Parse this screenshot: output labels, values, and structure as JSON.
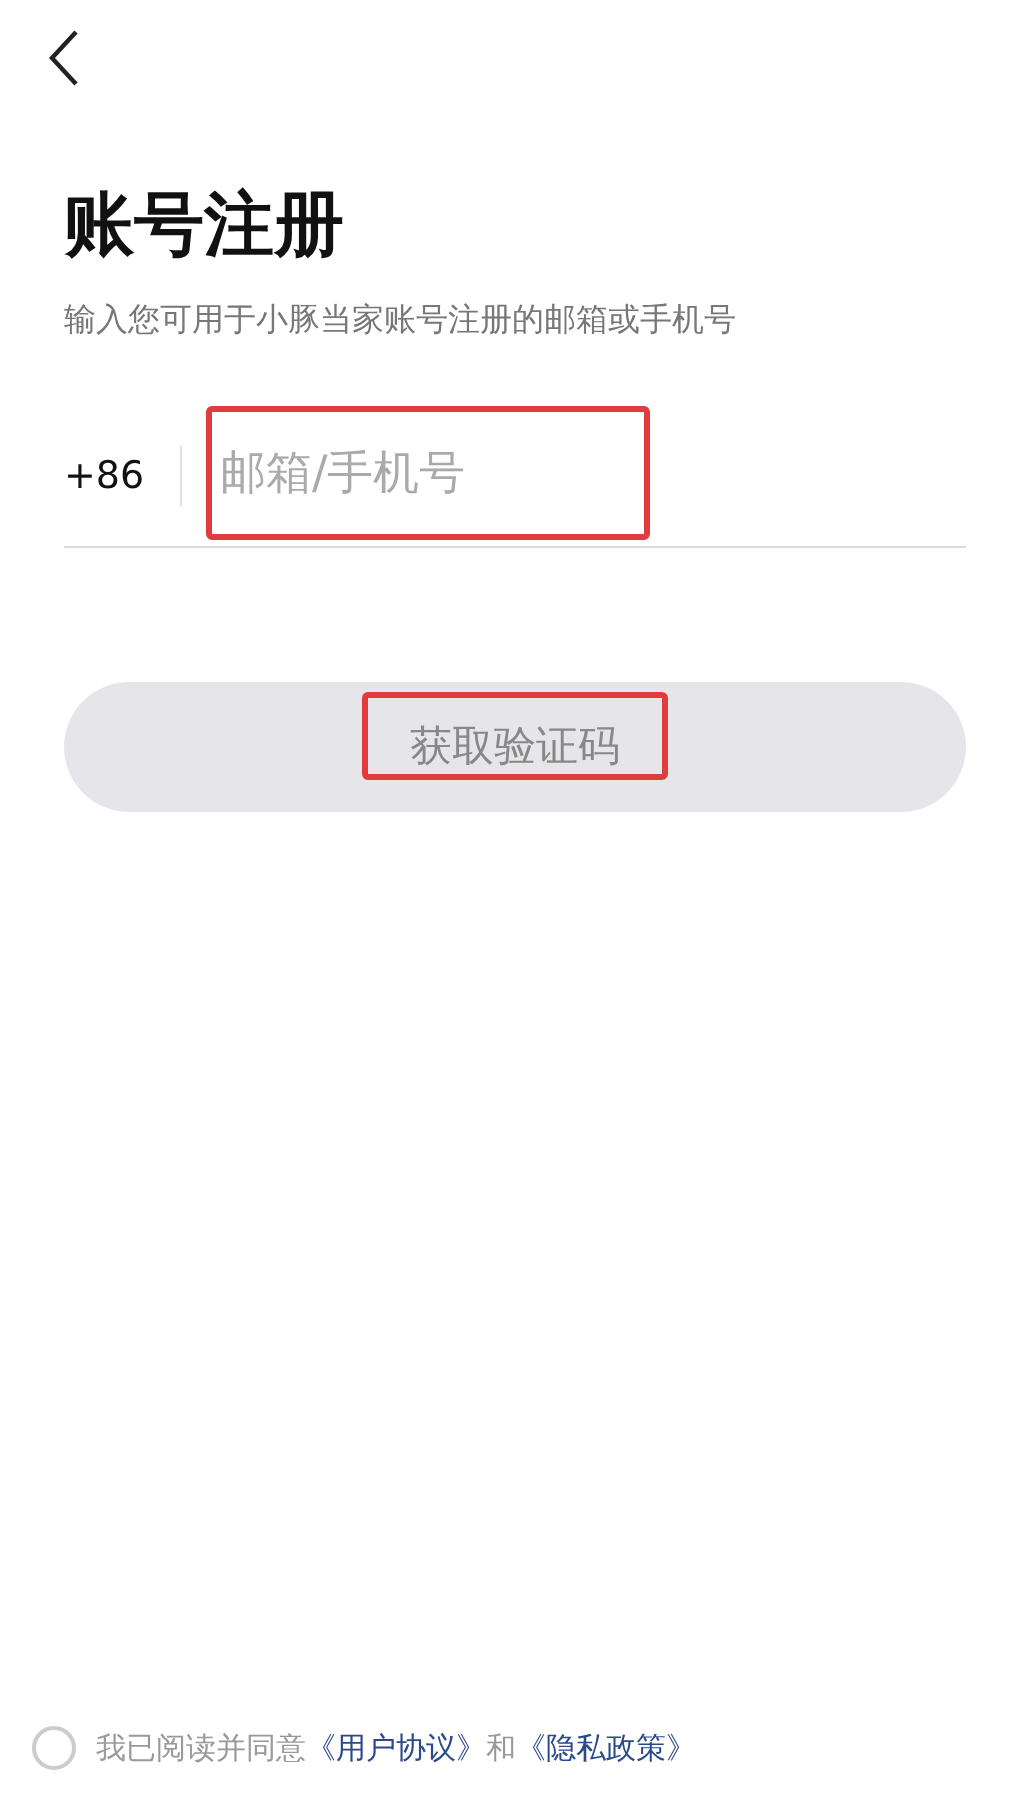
{
  "title": "账号注册",
  "subtitle": "输入您可用于小豚当家账号注册的邮箱或手机号",
  "phone_field": {
    "country_code": "+86",
    "placeholder": "邮箱/手机号",
    "highlighted": true
  },
  "submit_button": {
    "label": "获取验证码",
    "disabled": true,
    "highlighted": true
  },
  "agreement": {
    "checked": false,
    "segments": [
      {
        "kind": "text",
        "text": "我已阅读并同意"
      },
      {
        "kind": "link",
        "text": "《用户协议》"
      },
      {
        "kind": "text",
        "text": "和"
      },
      {
        "kind": "link",
        "text": "《隐私政策》"
      }
    ]
  }
}
